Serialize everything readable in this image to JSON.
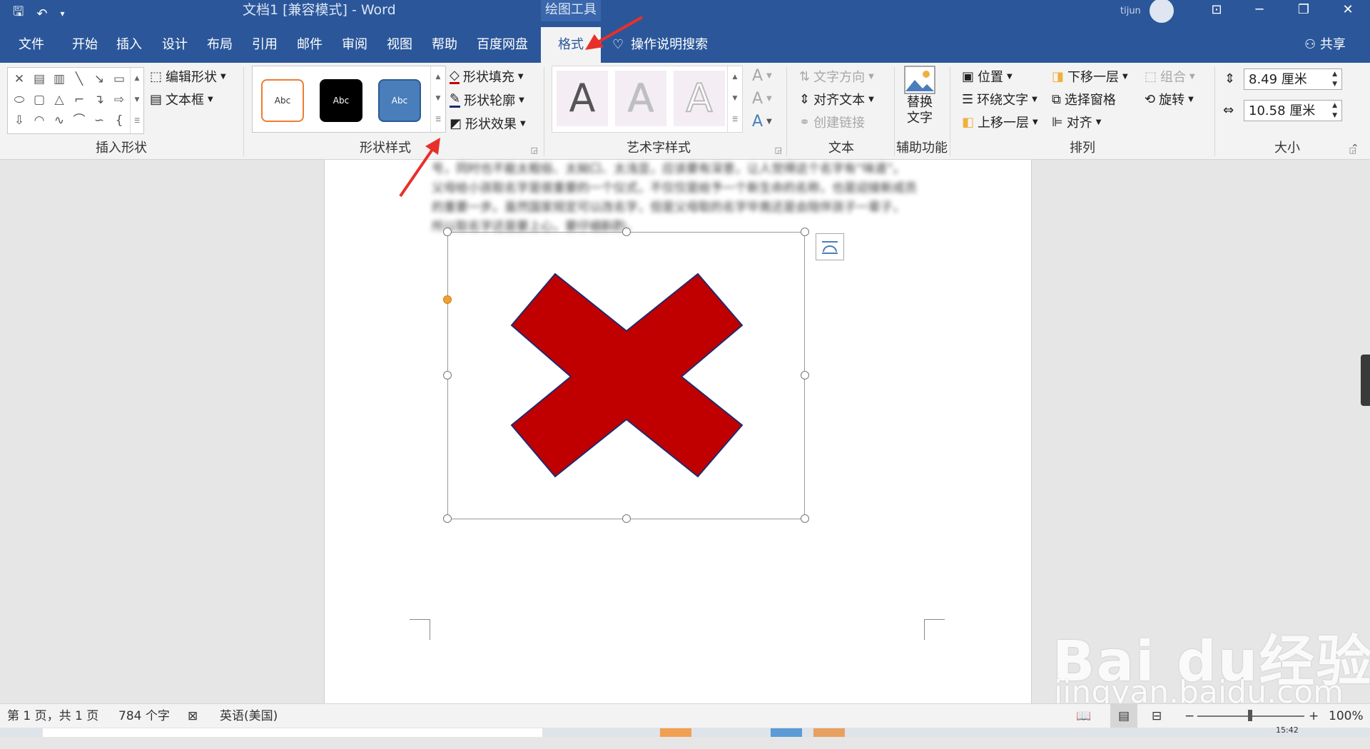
{
  "app": {
    "doc_title": "文档1 [兼容模式]  -  Word",
    "tools_label": "绘图工具",
    "user_name": "tijun"
  },
  "qat": {
    "save_icon": "save-icon",
    "undo_icon": "undo-icon",
    "customize_icon": "customize-qat-icon"
  },
  "window": {
    "display_options_icon": "ribbon-display-icon",
    "minimize": "─",
    "restore": "❐",
    "close": "✕"
  },
  "tabs": [
    {
      "label": "文件"
    },
    {
      "label": "开始"
    },
    {
      "label": "插入"
    },
    {
      "label": "设计"
    },
    {
      "label": "布局"
    },
    {
      "label": "引用"
    },
    {
      "label": "邮件"
    },
    {
      "label": "审阅"
    },
    {
      "label": "视图"
    },
    {
      "label": "帮助"
    },
    {
      "label": "百度网盘"
    },
    {
      "label": "格式",
      "active": true
    }
  ],
  "tell_me": "操作说明搜索",
  "share": "共享",
  "ribbon": {
    "insert_shapes": {
      "label": "插入形状",
      "edit_shape": "编辑形状",
      "text_box": "文本框"
    },
    "shape_styles": {
      "label": "形状样式",
      "swatches": [
        "Abc",
        "Abc",
        "Abc"
      ],
      "fill": "形状填充",
      "outline": "形状轮廓",
      "effects": "形状效果"
    },
    "wordart": {
      "label": "艺术字样式",
      "sample": "A"
    },
    "text": {
      "label": "文本",
      "direction": "文字方向",
      "align": "对齐文本",
      "link": "创建链接"
    },
    "accessibility": {
      "label": "辅助功能",
      "alt_text_line1": "替换",
      "alt_text_line2": "文字"
    },
    "arrange": {
      "label": "排列",
      "position": "位置",
      "wrap": "环绕文字",
      "bring_forward": "上移一层",
      "send_backward": "下移一层",
      "selection_pane": "选择窗格",
      "align": "对齐",
      "group": "组合",
      "rotate": "旋转"
    },
    "size": {
      "label": "大小",
      "height": "8.49 厘米",
      "width": "10.58 厘米"
    }
  },
  "document": {
    "body_text": [
      "号，同时也不能太粗俗、太拗口、太浅显，应该要有深意，让人觉得这个名字有“味道”。",
      "父母给小孩取名字是很重要的一个仪式，不仅仅是给予一个新生命的名称，也是迎接新成员",
      "的重要一步。虽然国家规定可以改名字，但是父母取的名字毕竟还是会陪伴孩子一辈子，",
      "所以取名字还是要上心，要仔细斟酌。"
    ],
    "shape_fill": "#c00000",
    "shape_outline": "#1f2a6e"
  },
  "watermark": {
    "logo": "Bai du经验",
    "url": "jingyan.baidu.com"
  },
  "status": {
    "page": "第 1 页，共 1 页",
    "words": "784 个字",
    "language": "英语(美国)",
    "zoom": "100%",
    "zoom_minus": "−",
    "zoom_plus": "+",
    "time": "15:42"
  },
  "colors": {
    "brand": "#2b579a",
    "annotation_arrow": "#e8302a"
  }
}
